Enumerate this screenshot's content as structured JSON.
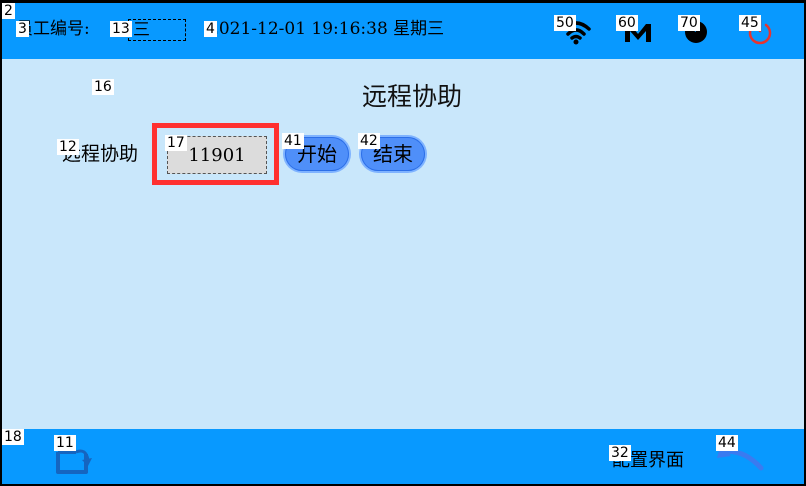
{
  "labels": {
    "window": "2",
    "employee": "3",
    "employee_value": "13",
    "datetime": "4",
    "wifi": "50",
    "mail": "60",
    "battery": "70",
    "power": "45",
    "main": "16",
    "remote_label": "12",
    "code_box": "17",
    "start": "41",
    "end": "42",
    "bottom": "18",
    "home": "11",
    "config": "32",
    "back": "44"
  },
  "header": {
    "employee_label": "员工编号:",
    "employee_value": "三",
    "datetime": "2021-12-01 19:16:38 星期三",
    "icons": {
      "wifi": "wifi-icon",
      "mail": "mail-icon",
      "battery": "battery-icon",
      "power": "power-icon"
    }
  },
  "main": {
    "title": "远程协助",
    "remote_label": "远程协助",
    "code": "11901",
    "start_label": "开始",
    "end_label": "结束"
  },
  "footer": {
    "config_label": "配置界面",
    "icons": {
      "home": "home-icon",
      "back": "back-icon"
    }
  },
  "colors": {
    "bar": "#0899ff",
    "background": "#c9e7fb",
    "button": "#4f8ff9",
    "highlight": "#ff3030",
    "power": "#e8342f"
  }
}
